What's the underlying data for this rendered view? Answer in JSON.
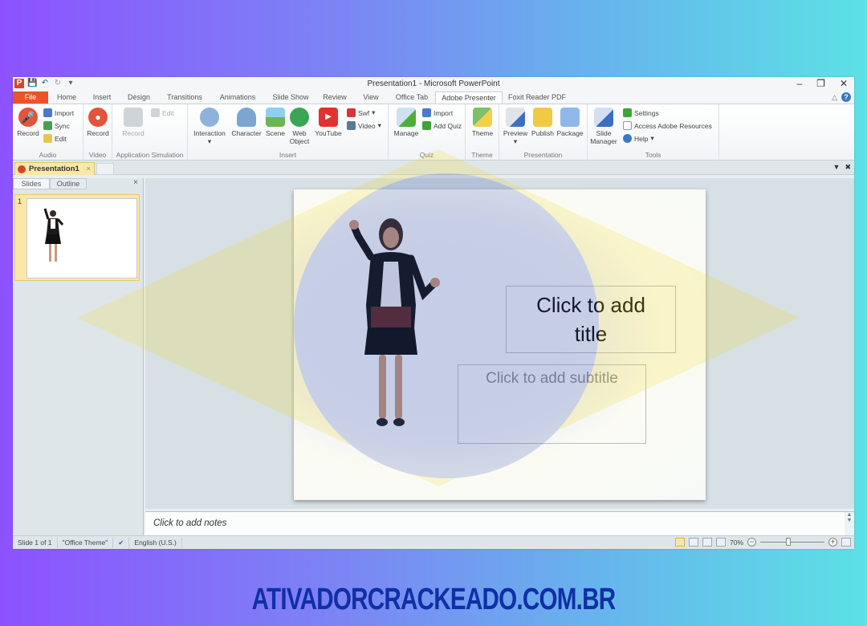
{
  "window": {
    "title": "Presentation1 - Microsoft PowerPoint",
    "controls": {
      "minimize": "–",
      "restore": "❐",
      "close": "✕"
    }
  },
  "quick_access": {
    "app_icon": "P",
    "save": "save-icon",
    "undo": "undo-icon",
    "redo": "redo-icon",
    "customize": "customize-icon"
  },
  "tabs": [
    {
      "label": "File"
    },
    {
      "label": "Home"
    },
    {
      "label": "Insert"
    },
    {
      "label": "Design"
    },
    {
      "label": "Transitions"
    },
    {
      "label": "Animations"
    },
    {
      "label": "Slide Show"
    },
    {
      "label": "Review"
    },
    {
      "label": "View"
    },
    {
      "label": "Office Tab"
    },
    {
      "label": "Adobe Presenter",
      "active": true
    },
    {
      "label": "Foxit Reader PDF"
    }
  ],
  "ribbon": {
    "audio": {
      "label": "Audio",
      "record": "Record",
      "import": "Import",
      "sync": "Sync",
      "edit": "Edit"
    },
    "video": {
      "label": "Video",
      "record": "Record"
    },
    "appsim": {
      "label": "Application Simulation",
      "record": "Record",
      "edit": "Edit"
    },
    "insert": {
      "label": "Insert",
      "interaction": "Interaction",
      "character": "Character",
      "scene": "Scene",
      "web_object": "Web Object",
      "youtube": "YouTube",
      "swf": "Swf",
      "video": "Video"
    },
    "quiz": {
      "label": "Quiz",
      "manage": "Manage",
      "import": "Import",
      "add_quiz": "Add Quiz"
    },
    "theme": {
      "label": "Theme",
      "theme": "Theme"
    },
    "presentation": {
      "label": "Presentation",
      "preview": "Preview",
      "publish": "Publish",
      "package": "Package"
    },
    "tools": {
      "label": "Tools",
      "slide_manager": "Slide Manager",
      "settings": "Settings",
      "access": "Access Adobe Resources",
      "help": "Help"
    }
  },
  "document_tab": {
    "label": "Presentation1",
    "close": "×"
  },
  "left_pane": {
    "tabs": [
      "Slides",
      "Outline"
    ],
    "close": "×",
    "slide_number": "1"
  },
  "slide": {
    "title_placeholder": "Click to add title",
    "subtitle_placeholder": "Click to add subtitle"
  },
  "notes": {
    "placeholder": "Click to add notes"
  },
  "status": {
    "slide_info": "Slide 1 of 1",
    "theme": "\"Office Theme\"",
    "language": "English (U.S.)",
    "zoom": "70%",
    "zoom_value": 70
  },
  "footer": {
    "brand_text": "ATIVADORCRACKEADO.COM.BR"
  },
  "colors": {
    "file_tab": "#e8542b",
    "brand_text": "#102fa6",
    "selection": "#fbe7a8"
  }
}
